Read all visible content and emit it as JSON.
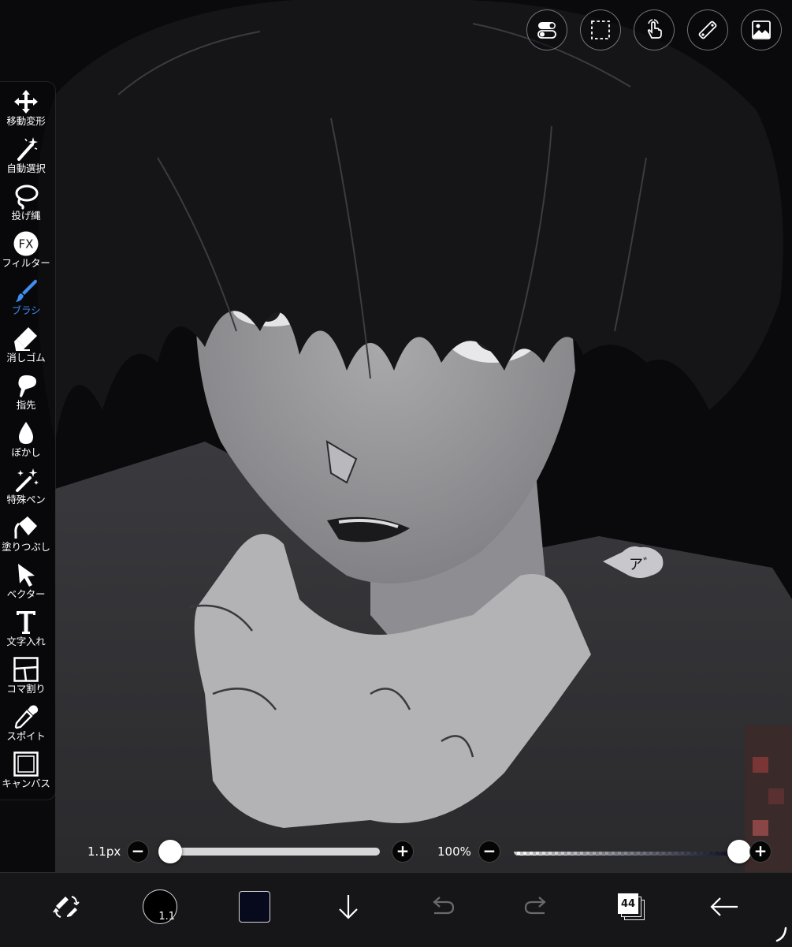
{
  "colors": {
    "accent": "#3f8ef0",
    "current_color": "#070a1c",
    "bottom_bar": "#161618"
  },
  "top_toolbar": [
    {
      "icon": "toggle-settings-icon"
    },
    {
      "icon": "selection-icon"
    },
    {
      "icon": "gesture-hand-icon"
    },
    {
      "icon": "ruler-icon"
    },
    {
      "icon": "material-image-icon"
    }
  ],
  "tools": [
    {
      "id": "move",
      "label": "移動変形",
      "icon": "move-arrows-icon"
    },
    {
      "id": "magic-wand",
      "label": "自動選択",
      "icon": "magic-wand-icon"
    },
    {
      "id": "lasso",
      "label": "投げ縄",
      "icon": "lasso-icon"
    },
    {
      "id": "filter",
      "label": "フィルター",
      "icon": "fx-filter-icon"
    },
    {
      "id": "brush",
      "label": "ブラシ",
      "icon": "brush-icon",
      "active": true
    },
    {
      "id": "eraser",
      "label": "消しゴム",
      "icon": "eraser-icon"
    },
    {
      "id": "smudge",
      "label": "指先",
      "icon": "smudge-finger-icon"
    },
    {
      "id": "blur",
      "label": "ぼかし",
      "icon": "blur-drop-icon"
    },
    {
      "id": "special-pen",
      "label": "特殊ペン",
      "icon": "special-pen-icon"
    },
    {
      "id": "fill",
      "label": "塗りつぶし",
      "icon": "bucket-fill-icon"
    },
    {
      "id": "vector",
      "label": "ベクター",
      "icon": "vector-arrow-icon"
    },
    {
      "id": "text",
      "label": "文字入れ",
      "icon": "text-t-icon"
    },
    {
      "id": "frame",
      "label": "コマ割り",
      "icon": "frame-divider-icon"
    },
    {
      "id": "eyedropper",
      "label": "スポイト",
      "icon": "eyedropper-icon"
    },
    {
      "id": "canvas",
      "label": "キャンバス",
      "icon": "canvas-icon"
    }
  ],
  "brush_size": {
    "label": "1.1px",
    "minus": "−",
    "plus": "+",
    "fraction": 0.0
  },
  "opacity": {
    "label": "100%",
    "minus": "−",
    "plus": "+",
    "fraction": 1.0
  },
  "bottom_bar": {
    "brush_size_value": "1.1",
    "layer_count": "44",
    "items": [
      "swap-tools-icon",
      "brush-size-circle",
      "color-swatch",
      "download-arrow-icon",
      "undo-icon",
      "redo-icon",
      "layers-icon",
      "back-arrow-icon"
    ]
  },
  "canvas": {
    "speech_text": "アﾞ"
  }
}
